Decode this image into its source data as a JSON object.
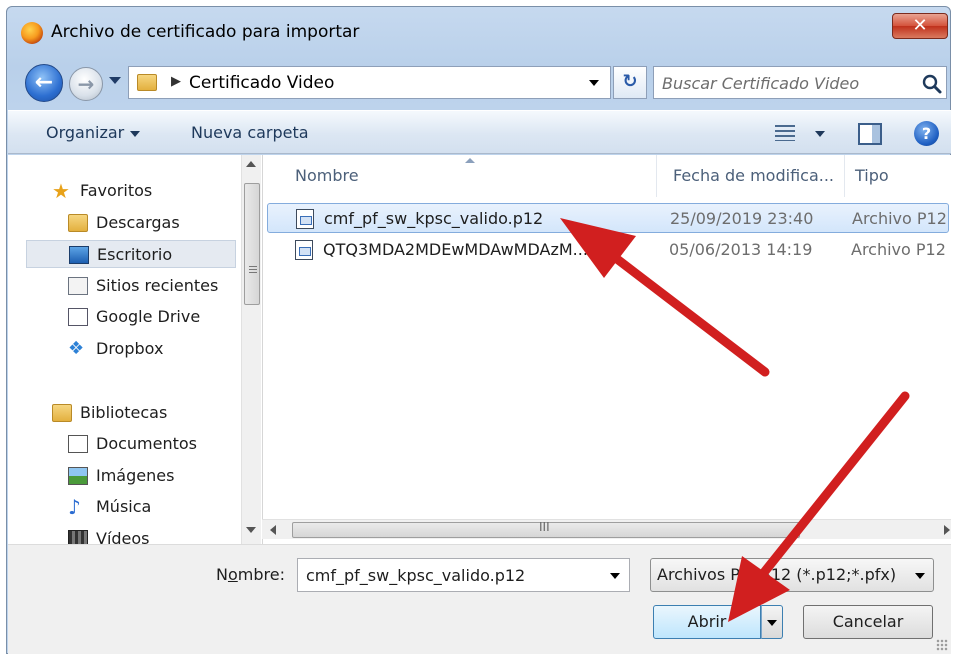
{
  "window": {
    "title": "Archivo de certificado para importar",
    "close_label": "✕"
  },
  "address": {
    "path": "Certificado Video",
    "search_placeholder": "Buscar Certificado Video"
  },
  "toolbar": {
    "organize_label": "Organizar",
    "new_folder_label": "Nueva carpeta"
  },
  "nav": {
    "favorites_label": "Favoritos",
    "favorites": [
      {
        "label": "Descargas",
        "icon": "downloads-folder-icon"
      },
      {
        "label": "Escritorio",
        "icon": "desktop-icon"
      },
      {
        "label": "Sitios recientes",
        "icon": "recent-places-icon"
      },
      {
        "label": "Google Drive",
        "icon": "google-drive-icon"
      },
      {
        "label": "Dropbox",
        "icon": "dropbox-icon"
      }
    ],
    "libraries_label": "Bibliotecas",
    "libraries": [
      {
        "label": "Documentos",
        "icon": "documents-icon"
      },
      {
        "label": "Imágenes",
        "icon": "pictures-icon"
      },
      {
        "label": "Música",
        "icon": "music-icon"
      },
      {
        "label": "Vídeos",
        "icon": "videos-icon"
      }
    ],
    "selected_item": "Escritorio"
  },
  "files": {
    "columns": [
      "Nombre",
      "Fecha de modifica...",
      "Tipo"
    ],
    "rows": [
      {
        "name": "cmf_pf_sw_kpsc_valido.p12",
        "date": "25/09/2019 23:40",
        "type": "Archivo P12",
        "selected": true
      },
      {
        "name": "QTQ3MDA2MDEwMDAwMDAzM...",
        "date": "05/06/2013 14:19",
        "type": "Archivo P12",
        "selected": false
      }
    ],
    "hscroll_grip": "III"
  },
  "footer": {
    "name_label_prefix": "N",
    "name_label_underlined": "o",
    "name_label_suffix": "mbre:",
    "name_value": "cmf_pf_sw_kpsc_valido.p12",
    "filter_value": "Archivos PKCS12 (*.p12;*.pfx)",
    "open_label": "Abrir",
    "cancel_label": "Cancelar"
  },
  "colors": {
    "annotation_arrow": "#d11f1f",
    "selection": "#cce4f7"
  }
}
